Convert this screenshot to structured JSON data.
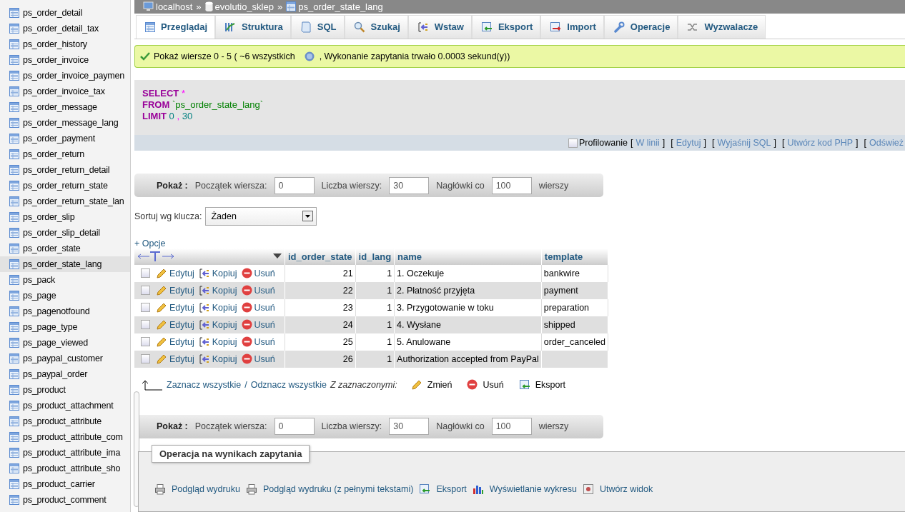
{
  "sidebar": {
    "items": [
      {
        "label": "ps_order_detail",
        "selected": false
      },
      {
        "label": "ps_order_detail_tax",
        "selected": false
      },
      {
        "label": "ps_order_history",
        "selected": false
      },
      {
        "label": "ps_order_invoice",
        "selected": false
      },
      {
        "label": "ps_order_invoice_paymen",
        "selected": false
      },
      {
        "label": "ps_order_invoice_tax",
        "selected": false
      },
      {
        "label": "ps_order_message",
        "selected": false
      },
      {
        "label": "ps_order_message_lang",
        "selected": false
      },
      {
        "label": "ps_order_payment",
        "selected": false
      },
      {
        "label": "ps_order_return",
        "selected": false
      },
      {
        "label": "ps_order_return_detail",
        "selected": false
      },
      {
        "label": "ps_order_return_state",
        "selected": false
      },
      {
        "label": "ps_order_return_state_lan",
        "selected": false
      },
      {
        "label": "ps_order_slip",
        "selected": false
      },
      {
        "label": "ps_order_slip_detail",
        "selected": false
      },
      {
        "label": "ps_order_state",
        "selected": false
      },
      {
        "label": "ps_order_state_lang",
        "selected": true
      },
      {
        "label": "ps_pack",
        "selected": false
      },
      {
        "label": "ps_page",
        "selected": false
      },
      {
        "label": "ps_pagenotfound",
        "selected": false
      },
      {
        "label": "ps_page_type",
        "selected": false
      },
      {
        "label": "ps_page_viewed",
        "selected": false
      },
      {
        "label": "ps_paypal_customer",
        "selected": false
      },
      {
        "label": "ps_paypal_order",
        "selected": false
      },
      {
        "label": "ps_product",
        "selected": false
      },
      {
        "label": "ps_product_attachment",
        "selected": false
      },
      {
        "label": "ps_product_attribute",
        "selected": false
      },
      {
        "label": "ps_product_attribute_com",
        "selected": false
      },
      {
        "label": "ps_product_attribute_ima",
        "selected": false
      },
      {
        "label": "ps_product_attribute_sho",
        "selected": false
      },
      {
        "label": "ps_product_carrier",
        "selected": false
      },
      {
        "label": "ps_product_comment",
        "selected": false
      }
    ]
  },
  "breadcrumb": [
    {
      "kind": "server",
      "label": "localhost"
    },
    {
      "kind": "database",
      "label": "evolutio_sklep"
    },
    {
      "kind": "table",
      "label": "ps_order_state_lang"
    }
  ],
  "breadcrumb_separator": "»",
  "tabs": [
    {
      "kind": "browse",
      "label": "Przeglądaj",
      "selected": true
    },
    {
      "kind": "structure",
      "label": "Struktura",
      "selected": false
    },
    {
      "kind": "sql",
      "label": "SQL",
      "selected": false
    },
    {
      "kind": "search",
      "label": "Szukaj",
      "selected": false
    },
    {
      "kind": "insert",
      "label": "Wstaw",
      "selected": false
    },
    {
      "kind": "export",
      "label": "Eksport",
      "selected": false
    },
    {
      "kind": "import",
      "label": "Import",
      "selected": false
    },
    {
      "kind": "operations",
      "label": "Operacje",
      "selected": false
    },
    {
      "kind": "triggers",
      "label": "Wyzwalacze",
      "selected": false
    }
  ],
  "success": {
    "text_before": "Pokaż wiersze 0 - 5 ( ~6 wszystkich",
    "text_after": ", Wykonanie zapytania trwało 0.0003 sekund(y))"
  },
  "sql": {
    "lines": [
      [
        {
          "kind": "keyword",
          "text": "SELECT"
        },
        {
          "kind": "operator",
          "text": "*"
        }
      ],
      [
        {
          "kind": "keyword",
          "text": "FROM"
        },
        {
          "kind": "string",
          "text": "`ps_order_state_lang`"
        }
      ],
      [
        {
          "kind": "keyword",
          "text": "LIMIT"
        },
        {
          "kind": "number",
          "text": "0"
        },
        {
          "kind": "operator",
          "text": ","
        },
        {
          "kind": "number",
          "text": "30"
        }
      ]
    ],
    "profiling": {
      "label": "Profilowanie",
      "checked": false
    },
    "links": [
      {
        "open": "[",
        "label": "W linii",
        "close": "]"
      },
      {
        "open": "[",
        "label": "Edytuj",
        "close": "]"
      },
      {
        "open": "[",
        "label": "Wyjaśnij SQL",
        "close": "]"
      },
      {
        "open": "[",
        "label": "Utwórz kod PHP",
        "close": "]"
      },
      {
        "open": "[",
        "label": "Odśwież"
      }
    ]
  },
  "navigation_top": {
    "title": "Pokaż :",
    "start_label": "Początek wiersza:",
    "start_value": "0",
    "count_label": "Liczba wierszy:",
    "count_value": "30",
    "headers_label": "Nagłówki co",
    "headers_value": "100",
    "suffix": "wierszy"
  },
  "sort": {
    "label": "Sortuj wg klucza:",
    "value": "Żaden"
  },
  "options_link": "+ Opcje",
  "table": {
    "columns": [
      {
        "label": "id_order_state",
        "kind": "number"
      },
      {
        "label": "id_lang",
        "kind": "number"
      },
      {
        "label": "name",
        "kind": "text"
      },
      {
        "label": "template",
        "kind": "text"
      }
    ],
    "rows": [
      {
        "checked": false,
        "edit": "Edytuj",
        "copy": "Kopiuj",
        "delete": "Usuń",
        "cells": [
          "21",
          "1",
          "1. Oczekuje",
          "bankwire"
        ]
      },
      {
        "checked": false,
        "edit": "Edytuj",
        "copy": "Kopiuj",
        "delete": "Usuń",
        "cells": [
          "22",
          "1",
          "2. Płatność przyjęta",
          "payment"
        ]
      },
      {
        "checked": false,
        "edit": "Edytuj",
        "copy": "Kopiuj",
        "delete": "Usuń",
        "cells": [
          "23",
          "1",
          "3. Przygotowanie w toku",
          "preparation"
        ]
      },
      {
        "checked": false,
        "edit": "Edytuj",
        "copy": "Kopiuj",
        "delete": "Usuń",
        "cells": [
          "24",
          "1",
          "4. Wysłane",
          "shipped"
        ]
      },
      {
        "checked": false,
        "edit": "Edytuj",
        "copy": "Kopiuj",
        "delete": "Usuń",
        "cells": [
          "25",
          "1",
          "5. Anulowane",
          "order_canceled"
        ]
      },
      {
        "checked": false,
        "edit": "Edytuj",
        "copy": "Kopiuj",
        "delete": "Usuń",
        "cells": [
          "26",
          "1",
          "Authorization accepted from PayPal",
          ""
        ]
      }
    ]
  },
  "bulk": {
    "select_all": "Zaznacz wszystkie",
    "separator": "/",
    "deselect_all": "Odznacz wszystkie",
    "with_selected": "Z zaznaczonymi:",
    "actions": [
      {
        "kind": "edit",
        "label": "Zmień"
      },
      {
        "kind": "delete",
        "label": "Usuń"
      },
      {
        "kind": "export",
        "label": "Eksport"
      }
    ]
  },
  "navigation_bottom": {
    "title": "Pokaż :",
    "start_label": "Początek wiersza:",
    "start_value": "0",
    "count_label": "Liczba wierszy:",
    "count_value": "30",
    "headers_label": "Nagłówki co",
    "headers_value": "100",
    "suffix": "wierszy"
  },
  "operations": {
    "legend": "Operacja na wynikach zapytania",
    "items": [
      {
        "kind": "print",
        "label": "Podgląd wydruku"
      },
      {
        "kind": "print",
        "label": "Podgląd wydruku (z pełnymi tekstami)"
      },
      {
        "kind": "export",
        "label": "Eksport"
      },
      {
        "kind": "chart",
        "label": "Wyświetlanie wykresu"
      },
      {
        "kind": "view",
        "label": "Utwórz widok"
      }
    ]
  }
}
